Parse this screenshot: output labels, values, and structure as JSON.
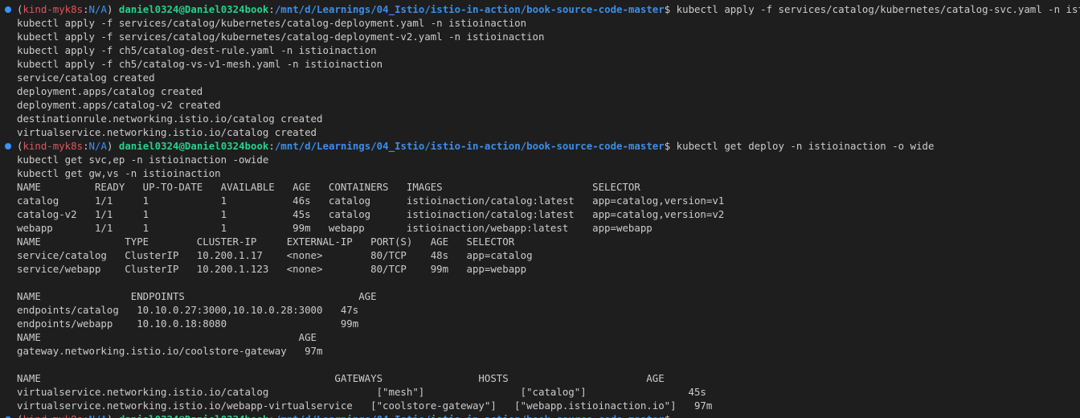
{
  "colors": {
    "background": "#1e1e1e",
    "text": "#cccccc",
    "prompt_env": "#e05561",
    "prompt_env_na": "#3794ff",
    "prompt_user": "#23d18b",
    "prompt_path": "#3b8eea",
    "prompt_dot": "#3794ff"
  },
  "prompt": {
    "indicator_icon": "terminal-prompt-dot-icon",
    "open_paren": "(",
    "context": "kind-myk8s",
    "separator": ":",
    "namespace": "N/A",
    "close_paren": ")",
    "user_host": "daniel0324@Daniel0324book",
    "path_separator": ":",
    "path": "/mnt/d/Learnings/04_Istio/istio-in-action/book-source-code-master",
    "dollar": "$"
  },
  "blocks": [
    {
      "command": "kubectl apply -f services/catalog/kubernetes/catalog-svc.yaml -n istioinaction",
      "output": [
        "kubectl apply -f services/catalog/kubernetes/catalog-deployment.yaml -n istioinaction",
        "kubectl apply -f services/catalog/kubernetes/catalog-deployment-v2.yaml -n istioinaction",
        "kubectl apply -f ch5/catalog-dest-rule.yaml -n istioinaction",
        "kubectl apply -f ch5/catalog-vs-v1-mesh.yaml -n istioinaction",
        "service/catalog created",
        "deployment.apps/catalog created",
        "deployment.apps/catalog-v2 created",
        "destinationrule.networking.istio.io/catalog created",
        "virtualservice.networking.istio.io/catalog created"
      ]
    },
    {
      "command": "kubectl get deploy -n istioinaction -o wide",
      "output": [
        "kubectl get svc,ep -n istioinaction -owide",
        "kubectl get gw,vs -n istioinaction",
        "NAME         READY   UP-TO-DATE   AVAILABLE   AGE   CONTAINERS   IMAGES                         SELECTOR",
        "catalog      1/1     1            1           46s   catalog      istioinaction/catalog:latest   app=catalog,version=v1",
        "catalog-v2   1/1     1            1           45s   catalog      istioinaction/catalog:latest   app=catalog,version=v2",
        "webapp       1/1     1            1           99m   webapp       istioinaction/webapp:latest    app=webapp",
        "NAME              TYPE        CLUSTER-IP     EXTERNAL-IP   PORT(S)   AGE   SELECTOR",
        "service/catalog   ClusterIP   10.200.1.17    <none>        80/TCP    48s   app=catalog",
        "service/webapp    ClusterIP   10.200.1.123   <none>        80/TCP    99m   app=webapp",
        "",
        "NAME               ENDPOINTS                             AGE",
        "endpoints/catalog   10.10.0.27:3000,10.10.0.28:3000   47s",
        "endpoints/webapp    10.10.0.18:8080                   99m",
        "NAME                                           AGE",
        "gateway.networking.istio.io/coolstore-gateway   97m",
        "",
        "NAME                                                 GATEWAYS                HOSTS                       AGE",
        "virtualservice.networking.istio.io/catalog                  [\"mesh\"]                [\"catalog\"]                 45s",
        "virtualservice.networking.istio.io/webapp-virtualservice   [\"coolstore-gateway\"]   [\"webapp.istioinaction.io\"]   97m"
      ]
    },
    {
      "command": "",
      "output": []
    }
  ]
}
